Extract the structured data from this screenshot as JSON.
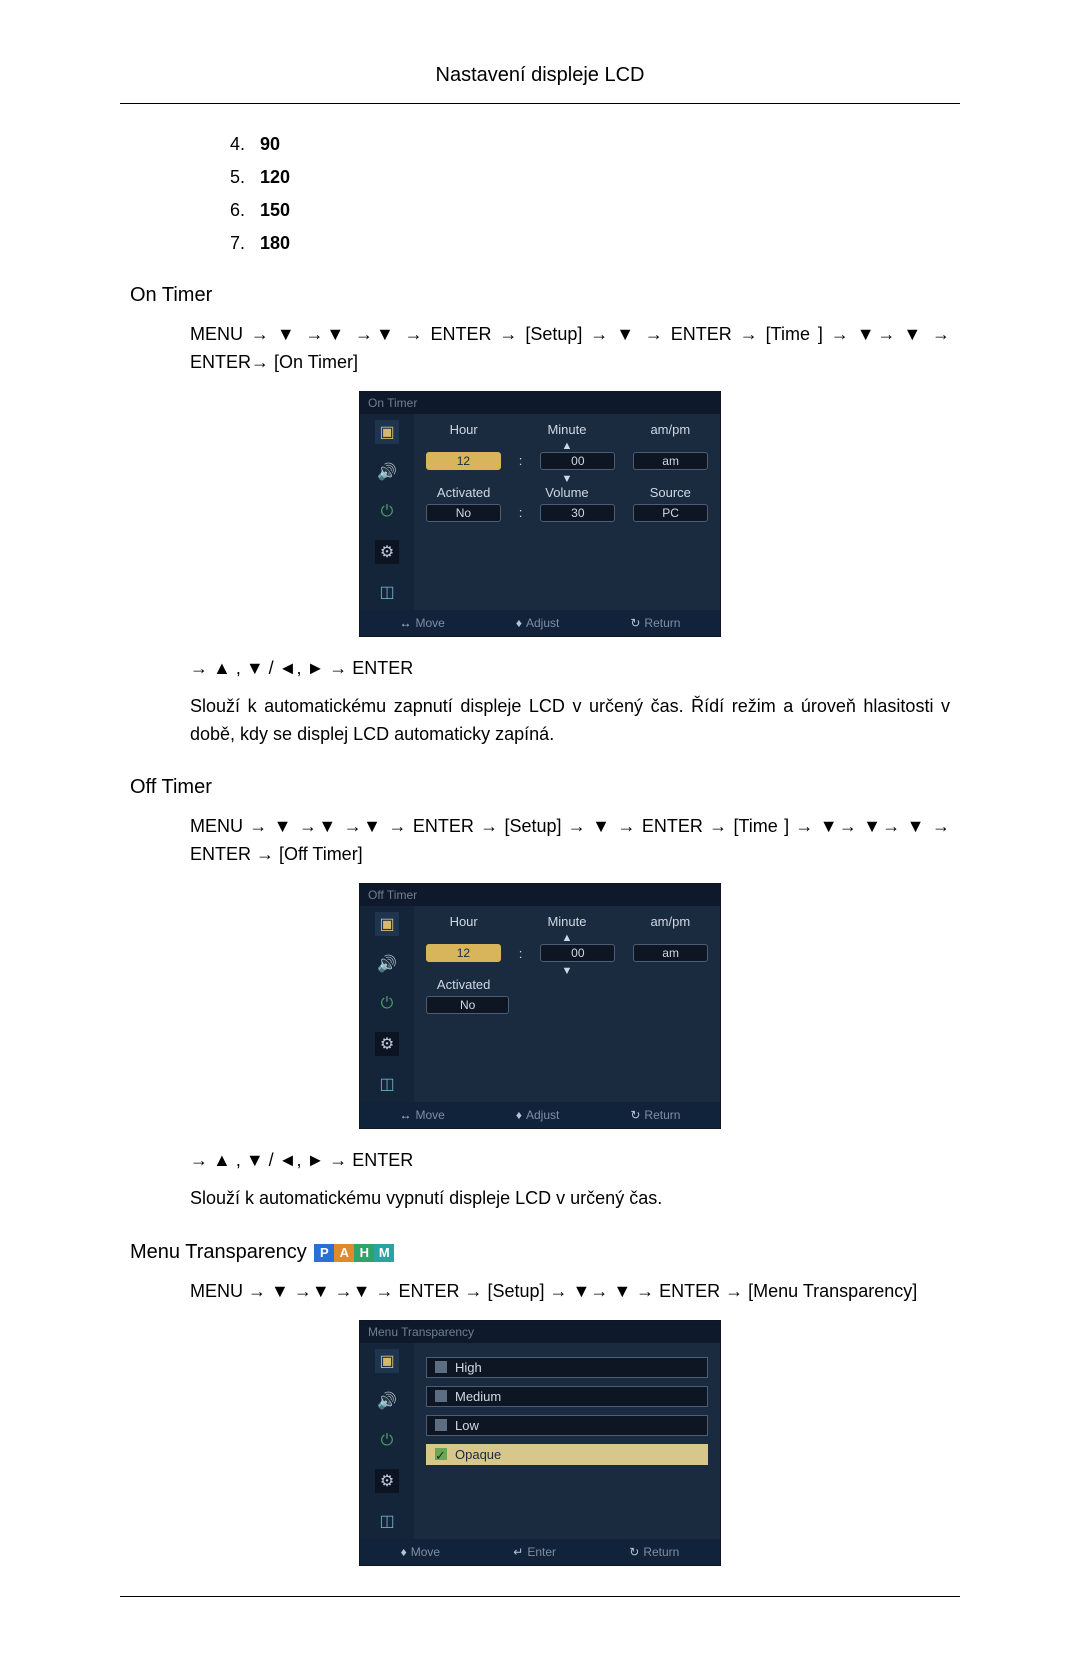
{
  "header": {
    "title": "Nastavení displeje LCD"
  },
  "list": [
    {
      "n": "4.",
      "v": "90"
    },
    {
      "n": "5.",
      "v": "120"
    },
    {
      "n": "6.",
      "v": "150"
    },
    {
      "n": "7.",
      "v": "180"
    }
  ],
  "sections": {
    "on": {
      "heading": "On Timer",
      "path": "MENU → ▼ →▼ →▼ → ENTER → [Setup] → ▼ → ENTER → [Time ] → ▼→ ▼ → ENTER→ [On Timer]",
      "nav_after_img": "→ ▲ , ▼ / ◄, ► → ENTER",
      "desc": "Slouží k automatickému zapnutí displeje LCD v určený čas. Řídí režim a úroveň hlasitosti v době, kdy se displej LCD automaticky zapíná."
    },
    "off": {
      "heading": "Off Timer",
      "path": "MENU → ▼ →▼ →▼ → ENTER → [Setup] → ▼ → ENTER → [Time ] → ▼→ ▼→ ▼ → ENTER → [Off Timer]",
      "nav_after_img": "→ ▲ , ▼ / ◄, ► → ENTER",
      "desc": "Slouží k automatickému vypnutí displeje LCD v určený čas."
    },
    "trans": {
      "heading": "Menu Transparency",
      "path": "MENU → ▼ →▼ →▼ → ENTER → [Setup] → ▼→ ▼ → ENTER → [Menu Transparency]"
    }
  },
  "osd_on": {
    "title": "On Timer",
    "row1_labels": [
      "Hour",
      "Minute",
      "am/pm"
    ],
    "row1_values": {
      "hour": "12",
      "minute": "00",
      "ampm": "am"
    },
    "row2_labels": [
      "Activated",
      "Volume",
      "Source"
    ],
    "row2_values": {
      "activated": "No",
      "volume": "30",
      "source": "PC"
    },
    "footer": {
      "move": "Move",
      "adjust": "Adjust",
      "return": "Return"
    }
  },
  "osd_off": {
    "title": "Off Timer",
    "row1_labels": [
      "Hour",
      "Minute",
      "am/pm"
    ],
    "row1_values": {
      "hour": "12",
      "minute": "00",
      "ampm": "am"
    },
    "row2_labels": [
      "Activated"
    ],
    "row2_values": {
      "activated": "No"
    },
    "footer": {
      "move": "Move",
      "adjust": "Adjust",
      "return": "Return"
    }
  },
  "osd_trans": {
    "title": "Menu Transparency",
    "items": [
      "High",
      "Medium",
      "Low",
      "Opaque"
    ],
    "selected_index": 3,
    "footer": {
      "move": "Move",
      "enter": "Enter",
      "return": "Return"
    }
  },
  "badges": [
    "P",
    "A",
    "H",
    "M"
  ],
  "glyphs": {
    "up": "▲",
    "down": "▼",
    "left": "◀",
    "right": "▶",
    "lr": "↔",
    "ud": "♦",
    "ret": "↻",
    "enter": "↵",
    "check": "✓"
  }
}
